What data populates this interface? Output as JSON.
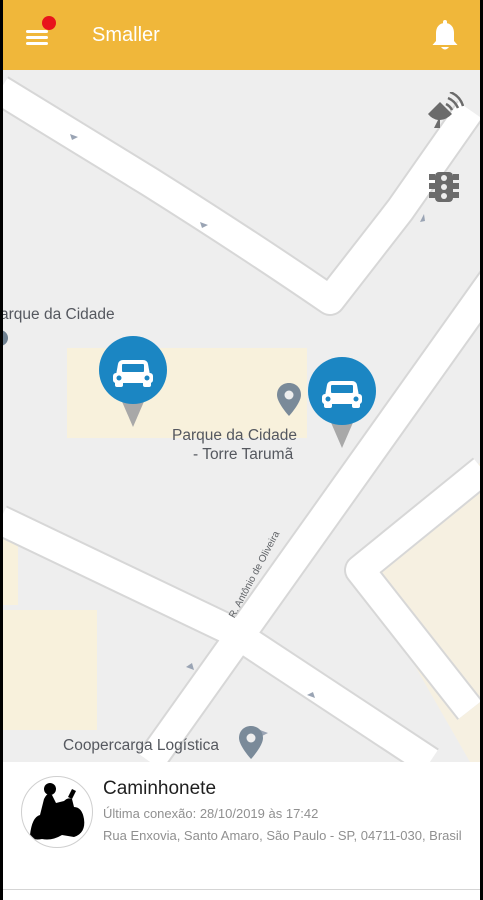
{
  "app": {
    "title": "Smaller"
  },
  "toolbar": {
    "menu_icon": "menu-icon",
    "notification_badge_color": "#e8141b",
    "bell_icon": "bell-icon"
  },
  "colors": {
    "appbar": "#f0b73a",
    "marker": "#1b86c3",
    "marker_tail": "#a8a8a8"
  },
  "map": {
    "controls": [
      {
        "name": "signal-icon"
      },
      {
        "name": "traffic-light-icon"
      }
    ],
    "labels": {
      "park_left": "arque da Cidade",
      "park_line1": "Parque da Cidade",
      "park_line2": "- Torre Tarumã",
      "street": "R. Antônio de Oliveira",
      "company": "Coopercarga Logística"
    }
  },
  "vehicle": {
    "name": "Caminhonete",
    "last_connection": "Última conexão: 28/10/2019 às 17:42",
    "address": "Rua Enxovia, Santo Amaro, São Paulo - SP, 04711-030, Brasil"
  }
}
